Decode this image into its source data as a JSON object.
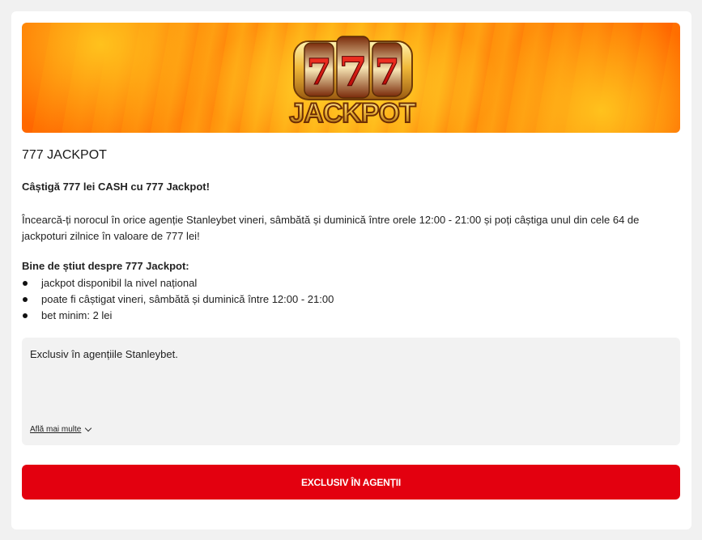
{
  "banner": {
    "logo_text": "777 JACKPOT"
  },
  "promo": {
    "title": "777 JACKPOT",
    "lead": "Câștigă 777 lei CASH cu 777 Jackpot!",
    "paragraph": "Încearcă-ți norocul în orice agenție Stanleybet vineri, sâmbătă și duminică între orele 12:00 - 21:00 și poți câștiga unul din cele 64 de jackpoturi zilnice în valoare de 777 lei!",
    "subheading": "Bine de știut despre 777 Jackpot:",
    "bullets": [
      "jackpot disponibil la nivel național",
      "poate fi câștigat vineri, sâmbătă și duminică între 12:00 - 21:00",
      "bet minim: 2 lei"
    ]
  },
  "info": {
    "text": "Exclusiv în agențiile Stanleybet.",
    "more_link": "Află mai multe"
  },
  "cta": {
    "label": "EXCLUSIV ÎN AGENȚII"
  },
  "colors": {
    "accent": "#e3000f",
    "banner_orange": "#ff8a00",
    "gold": "#f3c04a"
  }
}
